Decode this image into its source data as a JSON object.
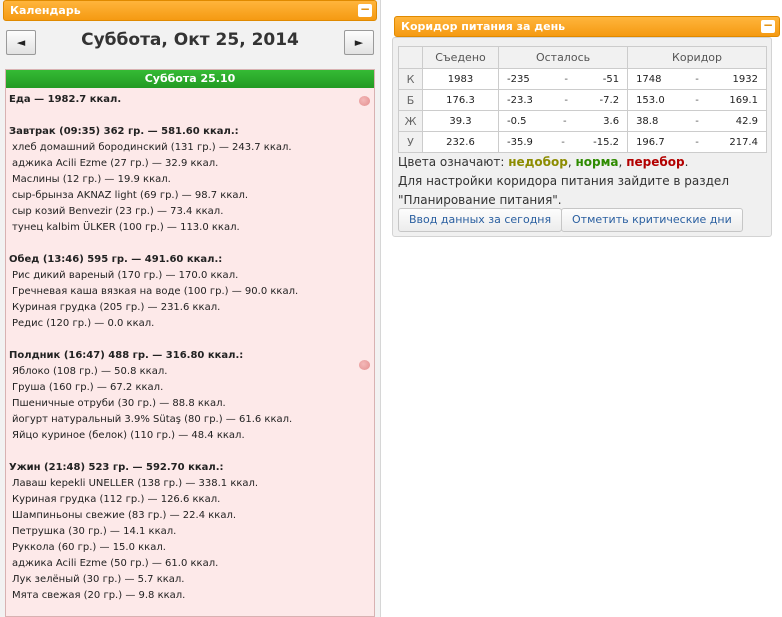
{
  "calendar": {
    "header": "Календарь",
    "minimize": "−",
    "prev": "◄",
    "next": "►",
    "date_title": "Суббота, Окт 25, 2014"
  },
  "day": {
    "header": "Суббота 25.10",
    "total": "Еда — 1982.7 ккал.",
    "meals": [
      {
        "title": "Завтрак (09:35) 362 гр. — 581.60 ккал.:",
        "items": [
          "хлеб домашний бородинский (131 гр.) — 243.7 ккал.",
          "аджика Acili Ezme (27 гр.) — 32.9 ккал.",
          "Маслины (12 гр.) — 19.9 ккал.",
          "сыр-брынза AKNAZ light (69 гр.) — 98.7 ккал.",
          "сыр козий Benvezir (23 гр.) — 73.4 ккал.",
          "тунец kalbim ÜLKER (100 гр.) — 113.0 ккал."
        ]
      },
      {
        "title": "Обед (13:46) 595 гр. — 491.60 ккал.:",
        "items": [
          "Рис дикий вареный (170 гр.) — 170.0 ккал.",
          "Гречневая каша вязкая на воде (100 гр.) — 90.0 ккал.",
          "Куриная грудка (205 гр.) — 231.6 ккал.",
          "Редис (120 гр.) — 0.0 ккал."
        ]
      },
      {
        "title": "Полдник (16:47) 488 гр. — 316.80 ккал.:",
        "items": [
          "Яблоко (108 гр.) — 50.8 ккал.",
          "Груша (160 гр.) — 67.2 ккал.",
          "Пшеничные отруби (30 гр.) — 88.8 ккал.",
          "йогурт натуральный 3.9% Sütaş (80 гр.) — 61.6 ккал.",
          "Яйцо куриное (белок) (110 гр.) — 48.4 ккал."
        ]
      },
      {
        "title": "Ужин (21:48) 523 гр. — 592.70 ккал.:",
        "items": [
          "Лаваш kepekli UNELLER (138 гр.) — 338.1 ккал.",
          "Куриная грудка (112 гр.) — 126.6 ккал.",
          "Шампиньоны свежие (83 гр.) — 22.4 ккал.",
          "Петрушка (30 гр.) — 14.1 ккал.",
          "Руккола (60 гр.) — 15.0 ккал.",
          "аджика Acili Ezme (50 гр.) — 61.0 ккал.",
          "Лук зелёный (30 гр.) — 5.7 ккал.",
          "Мята свежая (20 гр.) — 9.8 ккал."
        ]
      }
    ]
  },
  "corridor": {
    "header": "Коридор питания за день",
    "minimize": "−",
    "columns": [
      "Съедено",
      "Осталось",
      "Коридор"
    ],
    "rows": [
      {
        "label": "К",
        "eaten": "1983",
        "eaten_color": "red",
        "left_min": "-235",
        "left_max": "-51",
        "corr_min": "1748",
        "corr_max": "1932"
      },
      {
        "label": "Б",
        "eaten": "176.3",
        "eaten_color": "red",
        "left_min": "-23.3",
        "left_max": "-7.2",
        "corr_min": "153.0",
        "corr_max": "169.1"
      },
      {
        "label": "Ж",
        "eaten": "39.3",
        "eaten_color": "green",
        "left_min": "-0.5",
        "left_max": "3.6",
        "corr_min": "38.8",
        "corr_max": "42.9"
      },
      {
        "label": "У",
        "eaten": "232.6",
        "eaten_color": "red",
        "left_min": "-35.9",
        "left_max": "-15.2",
        "corr_min": "196.7",
        "corr_max": "217.4"
      }
    ],
    "dash": "-",
    "legend": {
      "prefix": "Цвета означают:",
      "lack": "недобор",
      "sep1": ",",
      "norm": "норма",
      "sep2": ",",
      "over": "перебор",
      "end": ".",
      "note": "Для настройки коридора питания зайдите в раздел \"Планирование питания\"."
    },
    "colors": {
      "lack": "#8c8c00",
      "norm": "#2e8b00",
      "over": "#b20000"
    },
    "buttons": {
      "input": "Ввод данных за сегодня",
      "critical": "Отметить критические дни"
    }
  }
}
